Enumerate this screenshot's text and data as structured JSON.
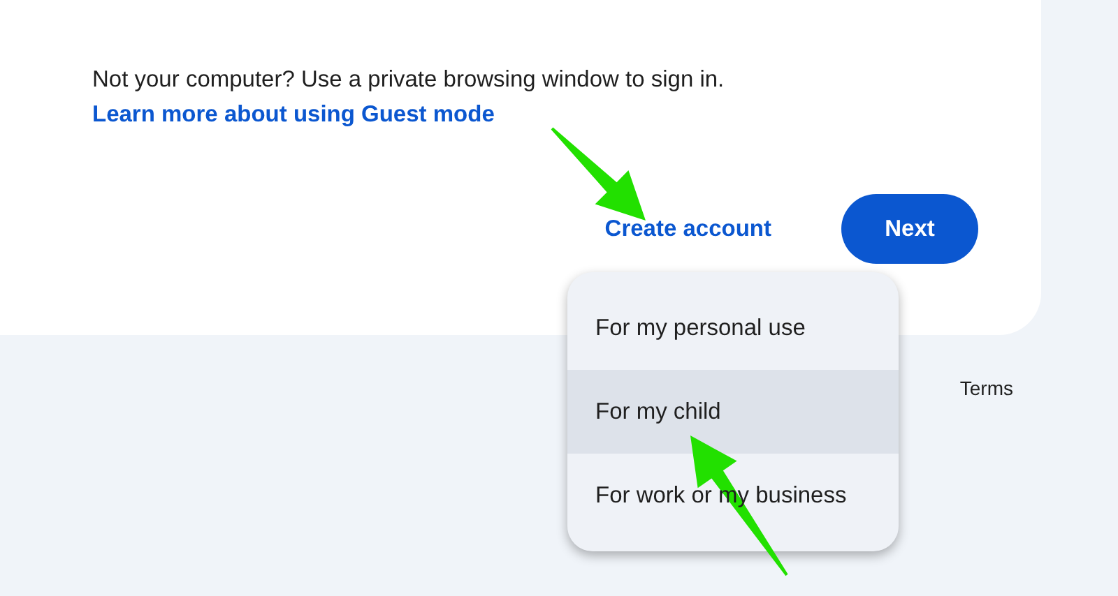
{
  "notice": {
    "text": "Not your computer? Use a private browsing window to sign in.",
    "link": "Learn more about using Guest mode"
  },
  "actions": {
    "create_account": "Create account",
    "next": "Next"
  },
  "menu": [
    {
      "label": "For my personal use",
      "selected": false
    },
    {
      "label": "For my child",
      "selected": true
    },
    {
      "label": "For work or my business",
      "selected": false
    }
  ],
  "footer": {
    "terms": "Terms"
  }
}
